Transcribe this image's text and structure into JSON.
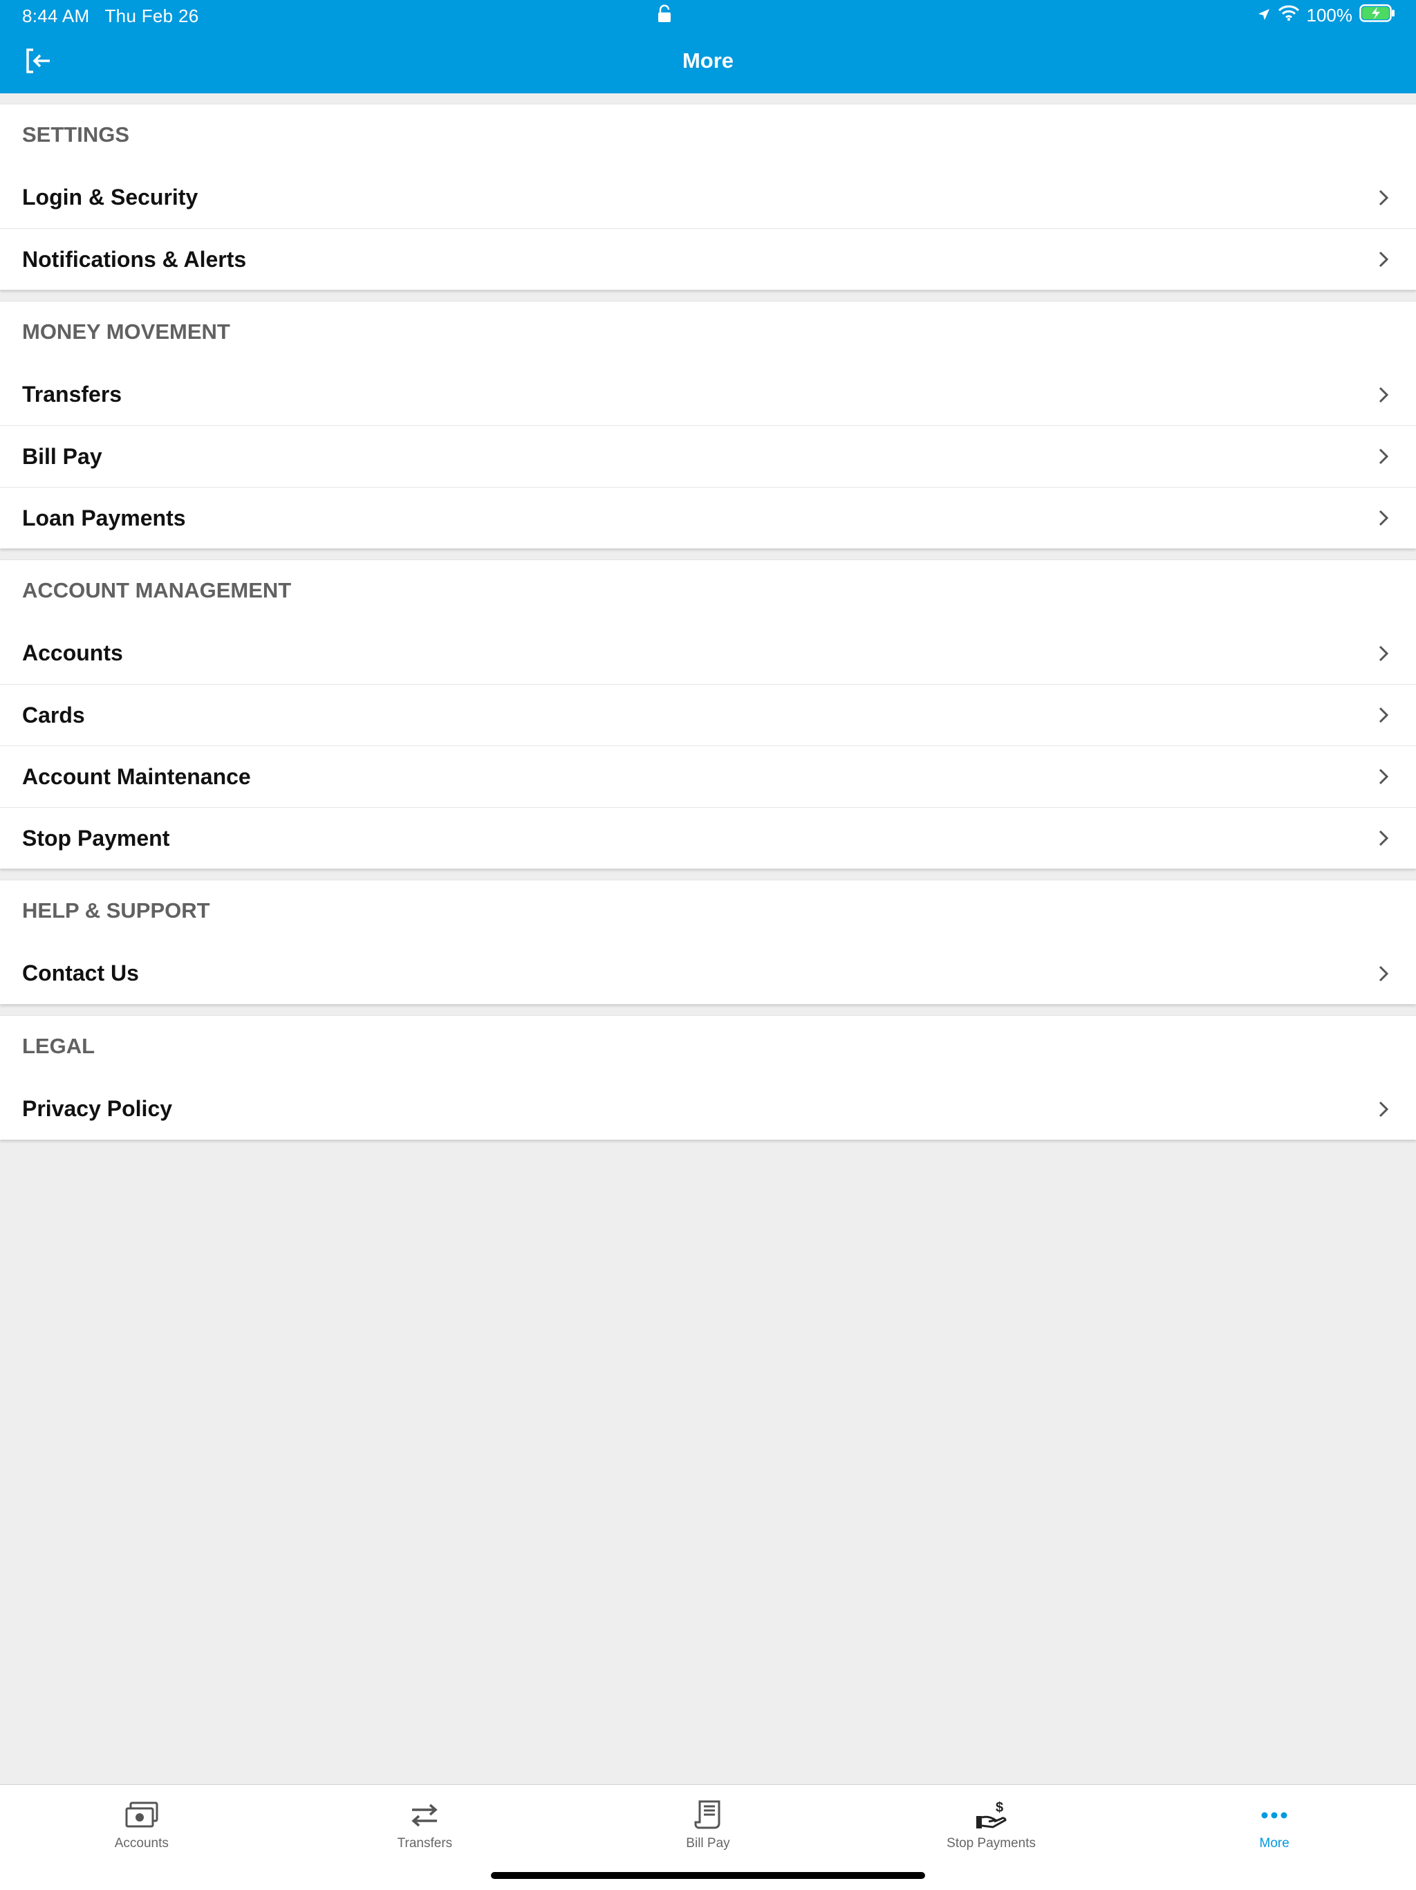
{
  "status_bar": {
    "time": "8:44 AM",
    "date": "Thu Feb 26",
    "battery": "100%"
  },
  "nav": {
    "title": "More"
  },
  "sections": [
    {
      "header": "SETTINGS",
      "items": [
        "Login & Security",
        "Notifications & Alerts"
      ]
    },
    {
      "header": "MONEY MOVEMENT",
      "items": [
        "Transfers",
        "Bill Pay",
        "Loan Payments"
      ]
    },
    {
      "header": "ACCOUNT MANAGEMENT",
      "items": [
        "Accounts",
        "Cards",
        "Account Maintenance",
        "Stop Payment"
      ]
    },
    {
      "header": "HELP & SUPPORT",
      "items": [
        "Contact Us"
      ]
    },
    {
      "header": "LEGAL",
      "items": [
        "Privacy Policy"
      ]
    }
  ],
  "tabs": [
    {
      "label": "Accounts",
      "icon": "cash-icon"
    },
    {
      "label": "Transfers",
      "icon": "transfer-arrows-icon"
    },
    {
      "label": "Bill Pay",
      "icon": "bill-icon"
    },
    {
      "label": "Stop Payments",
      "icon": "hand-dollar-icon"
    },
    {
      "label": "More",
      "icon": "ellipsis-icon",
      "active": true
    }
  ],
  "colors": {
    "brand": "#009ade",
    "background": "#eeeeee",
    "section_header": "#616161"
  }
}
